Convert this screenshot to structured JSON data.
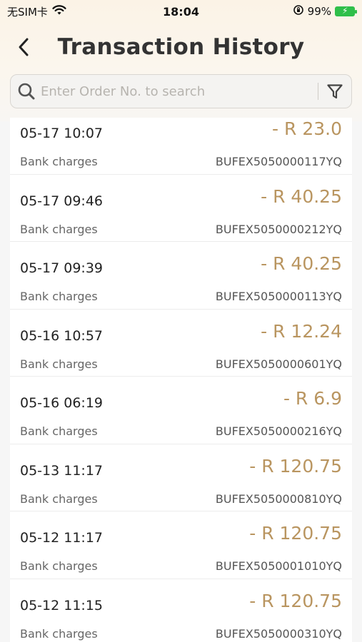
{
  "status_bar": {
    "carrier": "无SIM卡",
    "time": "18:04",
    "battery": "99%"
  },
  "header": {
    "title": "Transaction History"
  },
  "search": {
    "placeholder": "Enter Order No. to search"
  },
  "colors": {
    "amount": "#b99560",
    "header_bg": "#fbf3e6"
  },
  "transactions": [
    {
      "datetime": "05-17 10:07",
      "amount": "- R 23.0",
      "type": "Bank charges",
      "order_no": "BUFEX5050000117YQ"
    },
    {
      "datetime": "05-17 09:46",
      "amount": "- R 40.25",
      "type": "Bank charges",
      "order_no": "BUFEX5050000212YQ"
    },
    {
      "datetime": "05-17 09:39",
      "amount": "- R 40.25",
      "type": "Bank charges",
      "order_no": "BUFEX5050000113YQ"
    },
    {
      "datetime": "05-16 10:57",
      "amount": "- R 12.24",
      "type": "Bank charges",
      "order_no": "BUFEX5050000601YQ"
    },
    {
      "datetime": "05-16 06:19",
      "amount": "- R 6.9",
      "type": "Bank charges",
      "order_no": "BUFEX5050000216YQ"
    },
    {
      "datetime": "05-13 11:17",
      "amount": "- R 120.75",
      "type": "Bank charges",
      "order_no": "BUFEX5050000810YQ"
    },
    {
      "datetime": "05-12 11:17",
      "amount": "- R 120.75",
      "type": "Bank charges",
      "order_no": "BUFEX5050001010YQ"
    },
    {
      "datetime": "05-12 11:15",
      "amount": "- R 120.75",
      "type": "Bank charges",
      "order_no": "BUFEX5050000310YQ"
    }
  ]
}
